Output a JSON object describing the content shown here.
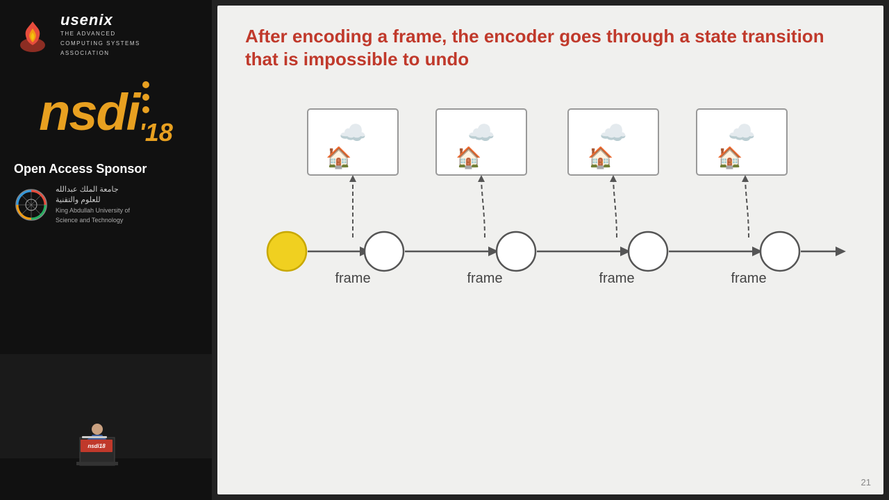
{
  "sidebar": {
    "usenix": {
      "title": "usenix",
      "subtitle_line1": "THE ADVANCED",
      "subtitle_line2": "COMPUTING SYSTEMS",
      "subtitle_line3": "ASSOCIATION"
    },
    "nsdi": {
      "name": "nsdi",
      "year": "'18",
      "dot_count": 3
    },
    "open_access": {
      "title": "Open Access Sponsor",
      "kaust_arabic_line1": "جامعة الملك عبدالله",
      "kaust_arabic_line2": "للعلوم والتقنية",
      "kaust_english_line1": "King Abdullah University of",
      "kaust_english_line2": "Science and Technology"
    }
  },
  "slide": {
    "title": "After encoding a frame, the encoder goes through a state transition that is impossible to undo",
    "slide_number": "21",
    "states": [
      {
        "id": 0,
        "filled": true
      },
      {
        "id": 1,
        "filled": false
      },
      {
        "id": 2,
        "filled": false
      },
      {
        "id": 3,
        "filled": false
      },
      {
        "id": 4,
        "filled": false
      }
    ],
    "frame_labels": [
      "frame",
      "frame",
      "frame",
      "frame"
    ],
    "frames": [
      {
        "id": 0,
        "emoji": "🏠☁️"
      },
      {
        "id": 1,
        "emoji": "🏠☁️"
      },
      {
        "id": 2,
        "emoji": "🏠☁️"
      },
      {
        "id": 3,
        "emoji": "🏠☁️"
      }
    ]
  },
  "colors": {
    "slide_title": "#c0392b",
    "nsdi_orange": "#e8a020",
    "circle_filled": "#f0d020",
    "arrow_color": "#555555"
  }
}
